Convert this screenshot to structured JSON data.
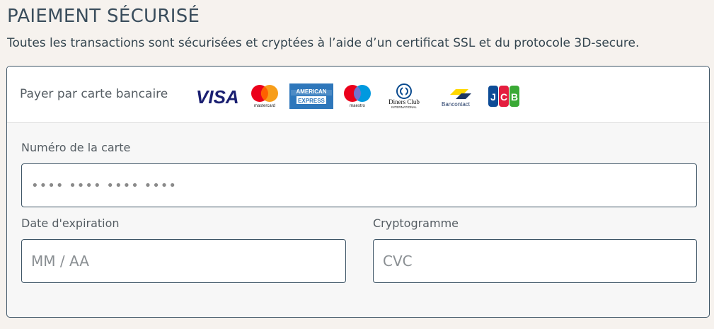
{
  "header": {
    "title": "PAIEMENT SÉCURISÉ",
    "subtitle": "Toutes les transactions sont sécurisées et cryptées à l’aide d’un certificat SSL et du protocole 3D-secure."
  },
  "payment": {
    "label": "Payer par carte bancaire",
    "card_logos": [
      {
        "name": "visa",
        "text": "VISA"
      },
      {
        "name": "mastercard",
        "text": "mastercard"
      },
      {
        "name": "american-express",
        "text": "AMERICAN EXPRESS"
      },
      {
        "name": "maestro",
        "text": "maestro"
      },
      {
        "name": "diners-club",
        "text": "Diners Club INTERNATIONAL"
      },
      {
        "name": "bancontact",
        "text": "Bancontact"
      },
      {
        "name": "jcb",
        "text": "JCB"
      }
    ]
  },
  "form": {
    "card_number_label": "Numéro de la carte",
    "card_number_value": "•••• •••• •••• ••••",
    "expiry_label": "Date d'expiration",
    "expiry_placeholder": "MM / AA",
    "cvc_label": "Cryptogramme",
    "cvc_placeholder": "CVC"
  },
  "colors": {
    "background": "#f6f2ee",
    "border": "#3e5566",
    "visa_blue": "#1a1f71",
    "mastercard_red": "#eb001b",
    "mastercard_orange": "#f79e1b",
    "amex_blue": "#2e77bb",
    "maestro_blue": "#0099df"
  }
}
